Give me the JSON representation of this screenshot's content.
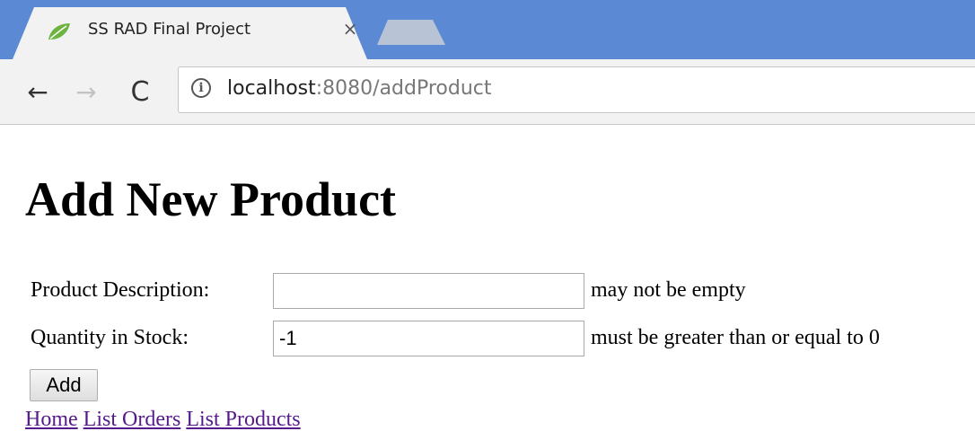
{
  "browser": {
    "tab": {
      "title": "SS RAD Final Project",
      "close_glyph": "×",
      "favicon": "spring-leaf-icon"
    },
    "toolbar": {
      "back_glyph": "←",
      "forward_glyph": "→",
      "reload_glyph": "C",
      "info_glyph": "i",
      "url_host": "localhost",
      "url_rest": ":8080/addProduct"
    },
    "colors": {
      "tabstrip": "#5b89d4",
      "toolbar": "#f2f2f2",
      "link": "#551a8b",
      "favicon": "#6db33f"
    }
  },
  "page": {
    "title": "Add New Product",
    "form": {
      "description_label": "Product Description:",
      "description_value": "",
      "description_error": "may not be empty",
      "quantity_label": "Quantity in Stock:",
      "quantity_value": "-1",
      "quantity_error": "must be greater than or equal to 0",
      "submit_label": "Add"
    },
    "links": {
      "home": "Home",
      "list_orders": "List Orders",
      "list_products": "List Products"
    }
  }
}
